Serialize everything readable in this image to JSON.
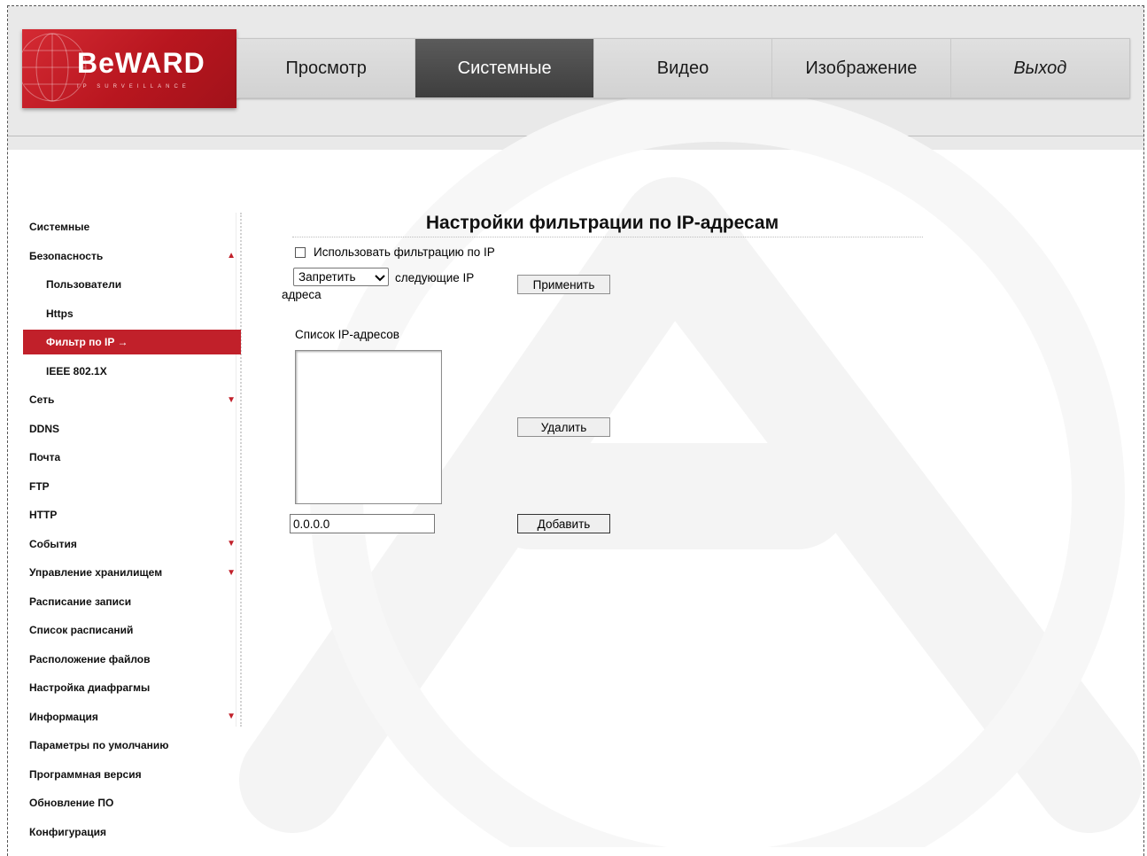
{
  "brand": {
    "name": "BeWARD",
    "tagline": "IP SURVEILLANCE"
  },
  "nav": {
    "tabs": [
      {
        "label": "Просмотр",
        "active": false
      },
      {
        "label": "Системные",
        "active": true
      },
      {
        "label": "Видео",
        "active": false
      },
      {
        "label": "Изображение",
        "active": false
      },
      {
        "label": "Выход",
        "active": false
      }
    ]
  },
  "sidebar": {
    "items": [
      {
        "label": "Системные",
        "level": 0
      },
      {
        "label": "Безопасность",
        "level": 0,
        "arrow": "up-triangle-icon"
      },
      {
        "label": "Пользователи",
        "level": 1
      },
      {
        "label": "Https",
        "level": 1
      },
      {
        "label": "Фильтр по IP →",
        "level": 1,
        "active": true
      },
      {
        "label": "IEEE 802.1X",
        "level": 1
      },
      {
        "label": "Сеть",
        "level": 0,
        "arrow": "down-triangle-icon"
      },
      {
        "label": "DDNS",
        "level": 0
      },
      {
        "label": "Почта",
        "level": 0
      },
      {
        "label": "FTP",
        "level": 0
      },
      {
        "label": "HTTP",
        "level": 0
      },
      {
        "label": "События",
        "level": 0,
        "arrow": "down-triangle-icon"
      },
      {
        "label": "Управление хранилищем",
        "level": 0,
        "arrow": "down-triangle-icon"
      },
      {
        "label": "Расписание записи",
        "level": 0
      },
      {
        "label": "Список расписаний",
        "level": 0
      },
      {
        "label": "Расположение файлов",
        "level": 0
      },
      {
        "label": "Настройка диафрагмы",
        "level": 0
      },
      {
        "label": "Информация",
        "level": 0,
        "arrow": "down-triangle-icon"
      },
      {
        "label": "Параметры по умолчанию",
        "level": 0
      },
      {
        "label": "Программная версия",
        "level": 0
      },
      {
        "label": "Обновление ПО",
        "level": 0
      },
      {
        "label": "Конфигурация",
        "level": 0
      }
    ]
  },
  "main": {
    "title": "Настройки фильтрации по IP-адресам",
    "use_filter_label": "Использовать фильтрацию по IP",
    "use_filter_checked": false,
    "mode_select_value": "Запретить",
    "after_select_text": "следующие IP",
    "wrap_text": "адреса",
    "apply_label": "Применить",
    "list_label": "Список IP-адресов",
    "delete_label": "Удалить",
    "ip_value": "0.0.0.0",
    "add_label": "Добавить"
  },
  "colors": {
    "accent": "#c1202a",
    "active_tab": "#4a4a4a"
  }
}
